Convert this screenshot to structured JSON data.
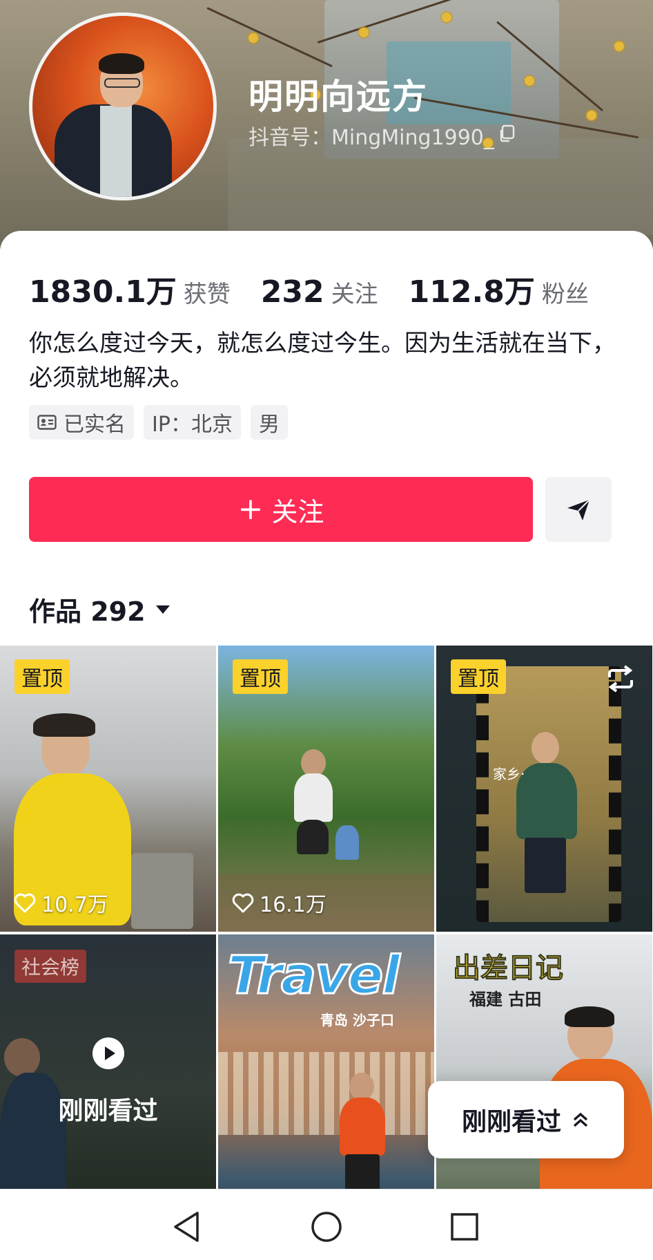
{
  "profile": {
    "display_name": "明明向远方",
    "douyin_id": "抖音号：MingMing1990_",
    "stats": [
      {
        "value": "1830.1万",
        "label": "获赞"
      },
      {
        "value": "232",
        "label": "关注"
      },
      {
        "value": "112.8万",
        "label": "粉丝"
      }
    ],
    "bio": "你怎么度过今天，就怎么度过今生。因为生活就在当下，必须就地解决。",
    "tags": {
      "verified": "已实名",
      "ip": "IP：北京",
      "gender": "男"
    }
  },
  "actions": {
    "follow_label": "关注",
    "follow_color": "#fe2c55"
  },
  "works": {
    "label": "作品 292",
    "pin_label": "置顶",
    "tiles": [
      {
        "likes": "10.7万"
      },
      {
        "likes": "16.1万"
      },
      {
        "overlay_text": "家乡·"
      },
      {
        "rank_badge": "社会榜",
        "watched_label": "刚刚看过"
      },
      {
        "title": "Travel",
        "subtitle": "青岛  沙子口"
      },
      {
        "title": "出差日记",
        "subtitle": "福建  古田"
      }
    ]
  },
  "popup": {
    "label": "刚刚看过"
  },
  "icons": {
    "copy": "copy-icon",
    "share": "send-icon",
    "heart": "heart-icon",
    "repost": "repost-icon",
    "play": "play-icon",
    "back": "nav-back-icon",
    "home": "nav-home-icon",
    "recents": "nav-recents-icon"
  }
}
